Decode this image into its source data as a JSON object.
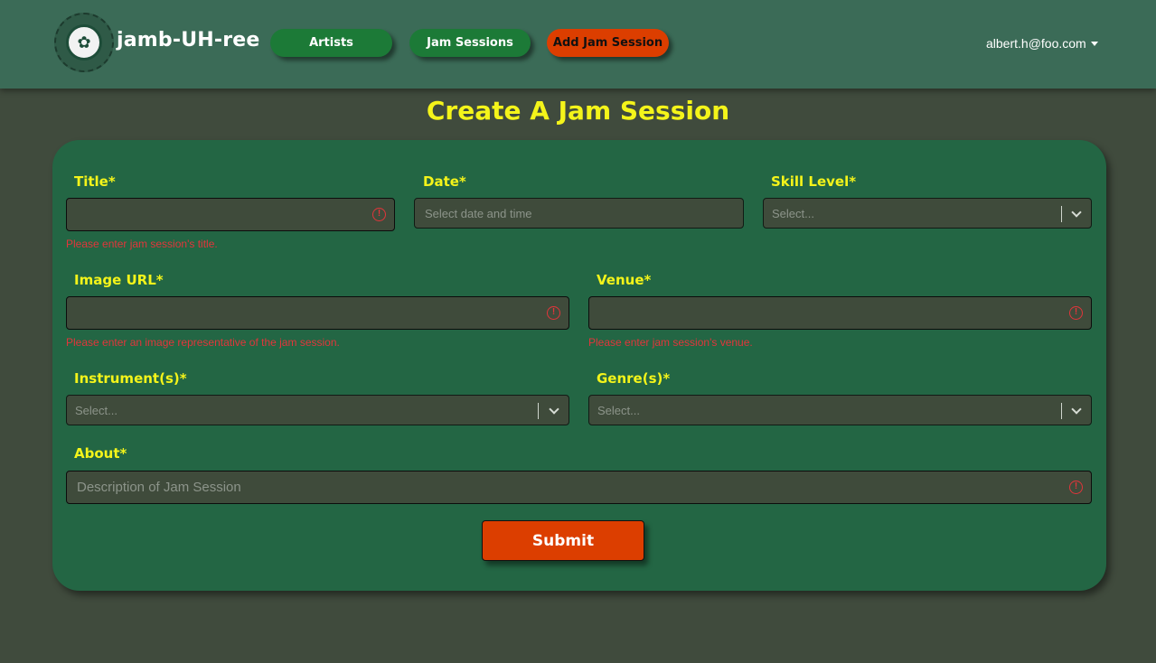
{
  "navbar": {
    "brand": "jamb-UH-ree",
    "logo_text": "✿",
    "links": [
      {
        "label": "Artists"
      },
      {
        "label": "Jam Sessions"
      },
      {
        "label": "Add Jam Session"
      }
    ],
    "user_email": "albert.h@foo.com"
  },
  "page": {
    "title": "Create A Jam Session"
  },
  "form": {
    "title": {
      "label": "Title*",
      "value": "",
      "error": "Please enter jam session's title."
    },
    "date": {
      "label": "Date*",
      "placeholder": "Select date and time"
    },
    "skill_level": {
      "label": "Skill Level*",
      "placeholder": "Select..."
    },
    "image_url": {
      "label": "Image URL*",
      "value": "",
      "error": "Please enter an image representative of the jam session."
    },
    "venue": {
      "label": "Venue*",
      "value": "",
      "error": "Please enter jam session's venue."
    },
    "instruments": {
      "label": "Instrument(s)*",
      "placeholder": "Select..."
    },
    "genres": {
      "label": "Genre(s)*",
      "placeholder": "Select..."
    },
    "about": {
      "label": "About*",
      "placeholder": "Description of Jam Session"
    },
    "submit_label": "Submit",
    "error_icon_glyph": "!"
  },
  "colors": {
    "background": "#404b3d",
    "navbar": "#3b6b57",
    "card": "#236644",
    "accent_yellow": "#f4f41a",
    "nav_green": "#1c7a37",
    "accent_orange": "#dc3e00",
    "error_red": "#e2353b"
  }
}
